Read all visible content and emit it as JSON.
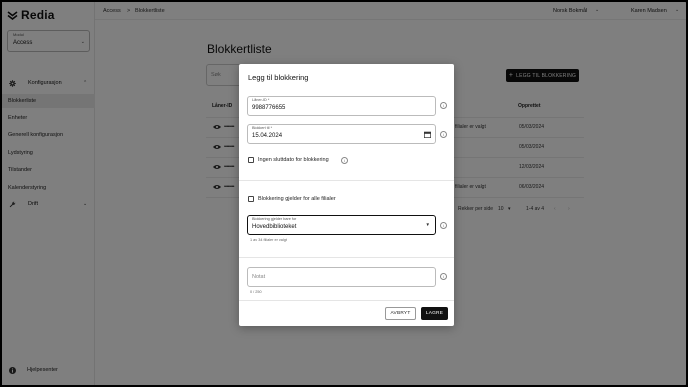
{
  "app": {
    "logo_text": "Redia"
  },
  "sidebar": {
    "module_label": "Modul",
    "module_value": "Access",
    "groups": [
      {
        "label": "Konfigurasjon",
        "icon": "gear-icon"
      },
      {
        "label": "Drift",
        "icon": "wrench-icon"
      }
    ],
    "items": [
      {
        "label": "Blokkerliste",
        "active": true
      },
      {
        "label": "Enheter"
      },
      {
        "label": "Generell konfigurasjon"
      },
      {
        "label": "Lydstyring"
      },
      {
        "label": "Tilstander"
      },
      {
        "label": "Kalenderstyring"
      }
    ],
    "help_label": "Hjelpesenter"
  },
  "topbar": {
    "breadcrumb": [
      "Access",
      ">",
      "Blokkertliste"
    ],
    "language": "Norsk Bokmål",
    "user": "Karen Madsen"
  },
  "page": {
    "title": "Blokkertliste",
    "search_placeholder": "Søk",
    "add_button": "LEGG TIL BLOKKERING",
    "table": {
      "columns": [
        "Låner-ID",
        "Opprettet"
      ],
      "rows": [
        {
          "mask": "••••••••",
          "branch": "filialer er valgt",
          "date": "05/03/2024"
        },
        {
          "mask": "••••••••",
          "branch": "",
          "date": "05/03/2024"
        },
        {
          "mask": "••••••••",
          "branch": "",
          "date": "12/03/2024"
        },
        {
          "mask": "••••••••",
          "branch": "filialer er valgt",
          "date": "06/03/2024"
        }
      ],
      "rows_per_page_label": "Rekker per side",
      "rows_per_page": "10",
      "range": "1-4 av 4"
    }
  },
  "dialog": {
    "title": "Legg til blokkering",
    "borrower_id": {
      "label": "Låner-ID *",
      "value": "9988776655"
    },
    "blocked_until": {
      "label": "Blokkert til *",
      "value": "15.04.2024"
    },
    "no_end_date_label": "Ingen sluttdato for blokkering",
    "all_branches_label": "Blokkering gjelder for alle filialer",
    "branch_select": {
      "label": "Blokkering gjelder bare for",
      "value": "Hovedbiblioteket",
      "helper": "1 av 34 filialer er valgt"
    },
    "note": {
      "placeholder": "Notat",
      "counter": "0 / 250"
    },
    "cancel_label": "AVBRYT",
    "save_label": "LAGRE"
  }
}
